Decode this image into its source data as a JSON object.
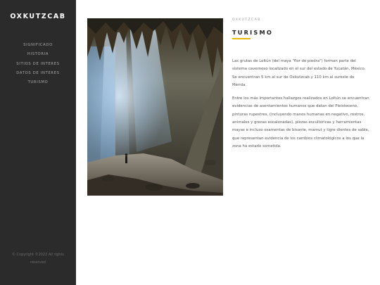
{
  "sidebar": {
    "logo": "OXKUTZCAB",
    "nav": [
      {
        "label": "SIGNIFICADO"
      },
      {
        "label": "HISTORIA"
      },
      {
        "label": "SITIOS DE INTERES"
      },
      {
        "label": "DATOS DE INTERES"
      },
      {
        "label": "TURISMO"
      }
    ],
    "copyright_line1": "© Copyright ©2022 All rights",
    "copyright_line2": "reserved"
  },
  "main": {
    "photo_subject": "cave-photo",
    "eyebrow": "OXKUTZCAB",
    "heading": "TURISMO",
    "accent_color": "#e6b800",
    "paragraph1": "Las grutas de Loltún (del maya \"flor de piedra\") forman parte del sistema cavernoso localizado en el sur del estado de Yucatán, México. Se encuentran 5 km al sur de Oxkutzcab y 110 km al sureste de Mérida.",
    "paragraph2": "Entre los más importantes hallazgos realizados en Loltún se encuentran evidencias de asentamientos humanos que datan del Pleistoceno, pinturas rupestres, (incluyendo manos humanas en negativo, rostros, animales y grecas escalonadas), piezas escultóricas y herramientas mayas e incluso osamentas de bisonte, mamut y tigre dientes de sable, que representan evidencia de los cambios climatológicos a los que la zona ha estado sometida."
  }
}
